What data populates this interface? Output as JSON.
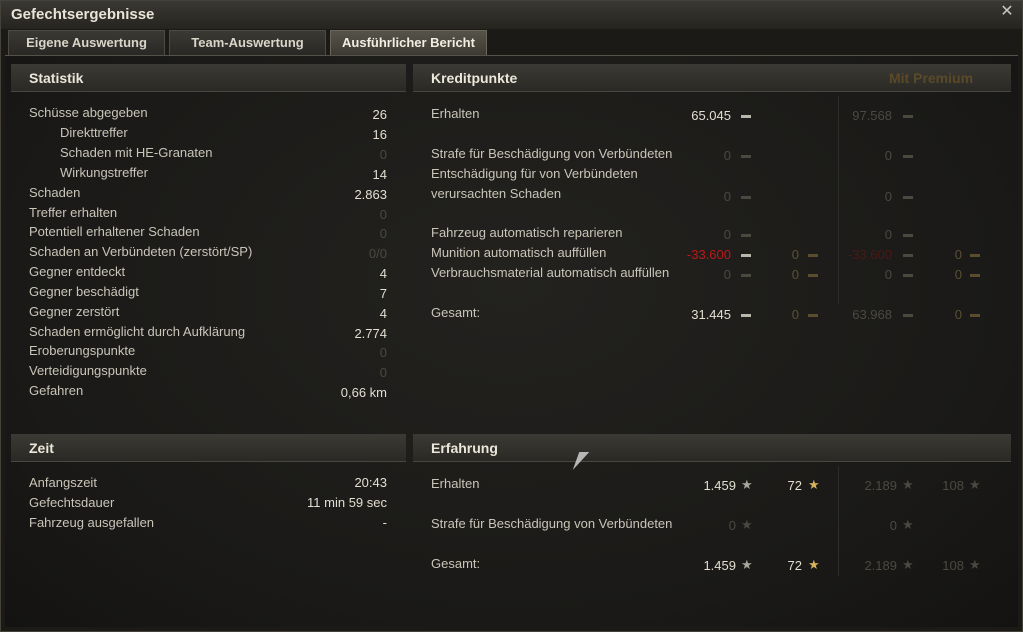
{
  "window": {
    "title": "Gefechtsergebnisse",
    "close_glyph": "✕"
  },
  "tabs": [
    "Eigene Auswertung",
    "Team-Auswertung",
    "Ausführlicher Bericht"
  ],
  "statistik": {
    "header": "Statistik",
    "rows": [
      {
        "label": "Schüsse abgegeben",
        "value": "26",
        "dim": false
      },
      {
        "label": "Direkttreffer",
        "value": "16",
        "dim": false
      },
      {
        "label": "Schaden mit HE-Granaten",
        "value": "0",
        "dim": true
      },
      {
        "label": "Wirkungstreffer",
        "value": "14",
        "dim": false
      },
      {
        "label": "Schaden",
        "value": "2.863",
        "dim": false
      },
      {
        "label": "Treffer erhalten",
        "value": "0",
        "dim": true
      },
      {
        "label": "Potentiell erhaltener Schaden",
        "value": "0",
        "dim": true
      },
      {
        "label": "Schaden an Verbündeten (zerstört/SP)",
        "value": "0/0",
        "dim": true
      },
      {
        "label": "Gegner entdeckt",
        "value": "4",
        "dim": false
      },
      {
        "label": "Gegner beschädigt",
        "value": "7",
        "dim": false
      },
      {
        "label": "Gegner zerstört",
        "value": "4",
        "dim": false
      },
      {
        "label": "Schaden ermöglicht durch Aufklärung",
        "value": "2.774",
        "dim": false
      },
      {
        "label": "Eroberungspunkte",
        "value": "0",
        "dim": true
      },
      {
        "label": "Verteidigungspunkte",
        "value": "0",
        "dim": true
      },
      {
        "label": "Gefahren",
        "value": "0,66 km",
        "dim": false
      }
    ]
  },
  "zeit": {
    "header": "Zeit",
    "rows": [
      {
        "label": "Anfangszeit",
        "value": "20:43"
      },
      {
        "label": "Gefechtsdauer",
        "value": "11 min 59 sec"
      },
      {
        "label": "Fahrzeug ausgefallen",
        "value": "-"
      }
    ]
  },
  "kreditpunkte": {
    "header": "Kreditpunkte",
    "premium_label": "Mit Premium",
    "rows": [
      {
        "label": "Erhalten",
        "credits": "65.045",
        "gold": "",
        "prem_credits": "97.568",
        "prem_gold": ""
      },
      {
        "label": "Strafe für Beschädigung von Verbündeten",
        "credits": "0",
        "gold": "",
        "prem_credits": "0",
        "prem_gold": ""
      },
      {
        "label": "Entschädigung für von Verbündeten",
        "label2": "verursachten Schaden",
        "credits": "0",
        "gold": "",
        "prem_credits": "0",
        "prem_gold": ""
      },
      {
        "label": "Fahrzeug automatisch reparieren",
        "credits": "0",
        "gold": "",
        "prem_credits": "0",
        "prem_gold": ""
      },
      {
        "label": "Munition automatisch auffüllen",
        "credits": "-33.600",
        "gold": "0",
        "prem_credits": "-33.600",
        "prem_gold": "0"
      },
      {
        "label": "Verbrauchsmaterial automatisch auffüllen",
        "credits": "0",
        "gold": "0",
        "prem_credits": "0",
        "prem_gold": "0"
      },
      {
        "label": "Gesamt:",
        "credits": "31.445",
        "gold": "0",
        "prem_credits": "63.968",
        "prem_gold": "0"
      }
    ]
  },
  "erfahrung": {
    "header": "Erfahrung",
    "rows": [
      {
        "label": "Erhalten",
        "xp": "1.459",
        "free_xp": "72",
        "prem_xp": "2.189",
        "prem_free_xp": "108"
      },
      {
        "label": "Strafe für Beschädigung von Verbündeten",
        "xp": "0",
        "free_xp": "",
        "prem_xp": "0",
        "prem_free_xp": ""
      },
      {
        "label": "Gesamt:",
        "xp": "1.459",
        "free_xp": "72",
        "prem_xp": "2.189",
        "prem_free_xp": "108"
      }
    ]
  },
  "icons": {
    "credit": "credits-icon",
    "gold": "gold-icon",
    "xp": "star-icon"
  },
  "colors": {
    "negative": "#c01818",
    "gold": "#bfa46a",
    "premium_header": "#5a4a2a"
  }
}
